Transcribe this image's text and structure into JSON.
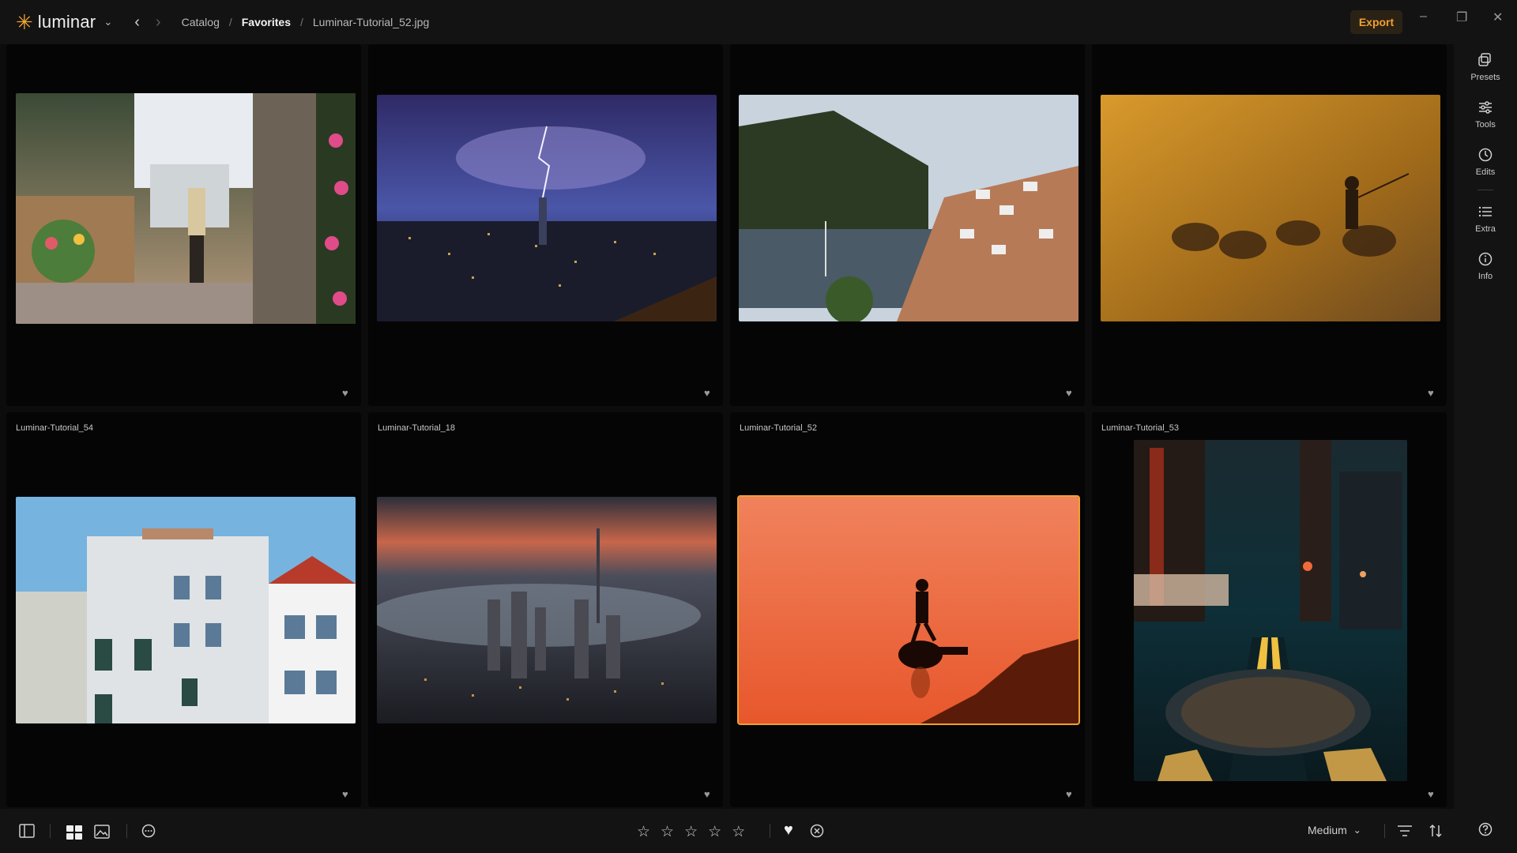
{
  "app": {
    "name": "luminar",
    "export_label": "Export"
  },
  "breadcrumb": {
    "items": [
      "Catalog",
      "Favorites",
      "Luminar-Tutorial_52.jpg"
    ]
  },
  "grid": {
    "rows": [
      {
        "cells": [
          {
            "caption": "",
            "favorite": true
          },
          {
            "caption": "",
            "favorite": true
          },
          {
            "caption": "",
            "favorite": true
          },
          {
            "caption": "",
            "favorite": true
          }
        ]
      },
      {
        "cells": [
          {
            "caption": "Luminar-Tutorial_54",
            "favorite": true
          },
          {
            "caption": "Luminar-Tutorial_18",
            "favorite": true
          },
          {
            "caption": "Luminar-Tutorial_52",
            "favorite": true,
            "selected": true
          },
          {
            "caption": "Luminar-Tutorial_53",
            "favorite": true
          }
        ]
      }
    ]
  },
  "right_panel": {
    "items": [
      {
        "label": "Presets",
        "icon": "presets-icon"
      },
      {
        "label": "Tools",
        "icon": "tools-icon"
      },
      {
        "label": "Edits",
        "icon": "edits-icon"
      },
      {
        "label": "Extra",
        "icon": "extra-icon"
      },
      {
        "label": "Info",
        "icon": "info-icon"
      }
    ]
  },
  "bottom_bar": {
    "thumbnail_size": "Medium",
    "rating_stars": 5,
    "accent_color": "#f0a032"
  }
}
